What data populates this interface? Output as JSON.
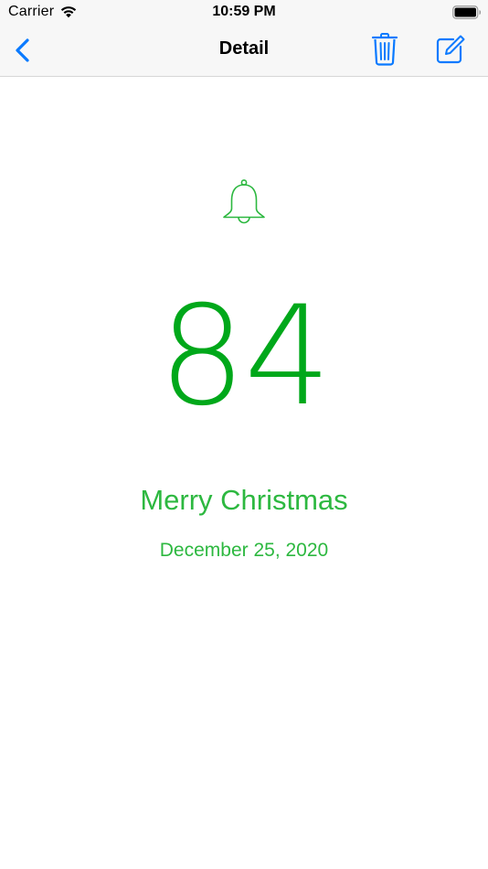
{
  "status_bar": {
    "carrier": "Carrier",
    "time": "10:59 PM",
    "icons": [
      "wifi-icon",
      "battery-icon"
    ]
  },
  "nav": {
    "title": "Detail",
    "back_icon": "chevron-left-icon",
    "actions": [
      "trash-icon",
      "compose-icon"
    ],
    "accent_color": "#0a7aff"
  },
  "event": {
    "icon": "bell-icon",
    "days": "84",
    "title": "Merry Christmas",
    "date": "December 25, 2020",
    "color": "#2db840",
    "number_color": "#00a81a"
  }
}
